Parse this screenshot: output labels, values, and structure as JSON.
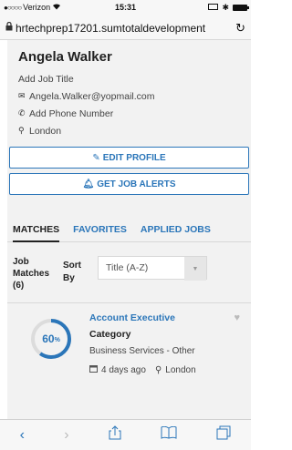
{
  "status_bar": {
    "carrier": "Verizon",
    "time": "15:31"
  },
  "browser": {
    "url": "hrtechprep17201.sumtotaldevelopment"
  },
  "profile": {
    "name": "Angela Walker",
    "job_title": "Add Job Title",
    "email": "Angela.Walker@yopmail.com",
    "phone": "Add Phone Number",
    "location": "London"
  },
  "buttons": {
    "edit_profile": "EDIT PROFILE",
    "get_job_alerts": "GET JOB ALERTS"
  },
  "tabs": [
    "MATCHES",
    "FAVORITES",
    "APPLIED JOBS"
  ],
  "sort": {
    "matches_label": "Job Matches",
    "matches_count": "(6)",
    "sort_label_1": "Sort",
    "sort_label_2": "By",
    "selected": "Title (A-Z)"
  },
  "job": {
    "match_value": "60",
    "match_unit": "%",
    "match_fraction": 0.6,
    "title": "Account Executive",
    "category_label": "Category",
    "category_value": "Business Services - Other",
    "posted": "4 days ago",
    "location": "London"
  },
  "colors": {
    "accent": "#2b76b9",
    "panel": "#f2f2f2"
  }
}
